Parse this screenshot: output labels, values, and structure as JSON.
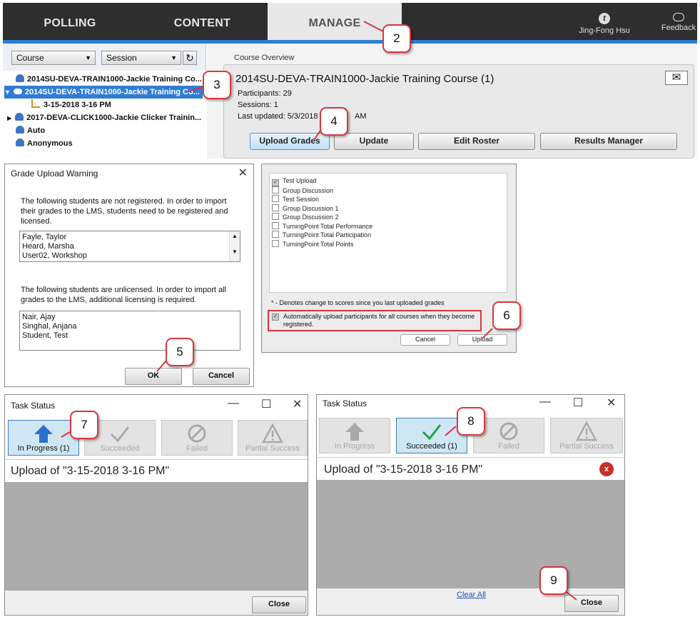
{
  "app": {
    "tabs": [
      "POLLING",
      "CONTENT",
      "MANAGE"
    ],
    "user_name": "Jing-Fong Hsu",
    "feedback_label": "Feedback",
    "course_dropdown": "Course",
    "session_dropdown": "Session",
    "tree": [
      {
        "label": "2014SU-DEVA-TRAIN1000-Jackie Training Co..."
      },
      {
        "label": "2014SU-DEVA-TRAIN1000-Jackie Training Co..."
      },
      {
        "label": "3-15-2018 3-16 PM"
      },
      {
        "label": "2017-DEVA-CLICK1000-Jackie Clicker Trainin..."
      },
      {
        "label": "Auto"
      },
      {
        "label": "Anonymous"
      }
    ],
    "overview_heading": "Course Overview",
    "course_title": "2014SU-DEVA-TRAIN1000-Jackie Training Course (1)",
    "participants": "Participants: 29",
    "sessions": "Sessions: 1",
    "last_updated": "Last updated: 5/3/2018",
    "last_updated_time": "AM",
    "buttons": [
      "Upload Grades",
      "Update",
      "Edit Roster",
      "Results Manager"
    ]
  },
  "warning": {
    "title": "Grade Upload Warning",
    "msg1": "The following students are not registered. In order to import their grades to the LMS, students need to be registered and licensed.",
    "list1": [
      "Fayle, Taylor",
      "Heard, Marsha",
      "User02, Workshop"
    ],
    "msg2": "The following students are unlicensed. In order to import all grades to the LMS, additional licensing is required.",
    "list2": [
      "Nair, Ajay",
      "Singhal, Anjana",
      "Student, Test"
    ],
    "ok": "OK",
    "cancel": "Cancel"
  },
  "upload_dialog": {
    "items": [
      "Test Upload",
      "Group Discussion",
      "Test Session",
      "Group Discussion 1",
      "Group Discussion 2",
      "TurningPoint Total Performance",
      "TurningPoint Total Participation",
      "TurningPoint Total Points"
    ],
    "note": "* - Denotes change to scores since you last uploaded grades",
    "auto_label": "Automatically upload participants for all courses when they become registered.",
    "cancel": "Cancel",
    "upload": "Upload"
  },
  "task1": {
    "title": "Task Status",
    "tiles": [
      "In Progress (1)",
      "Succeeded",
      "Failed",
      "Partial Success"
    ],
    "upload_text": "Upload of \"3-15-2018 3-16 PM\"",
    "close": "Close"
  },
  "task2": {
    "title": "Task Status",
    "tiles": [
      "In Progress",
      "Succeeded (1)",
      "Failed",
      "Partial Success"
    ],
    "upload_text": "Upload of \"3-15-2018 3-16 PM\"",
    "clear_all": "Clear All",
    "close": "Close"
  },
  "callouts": [
    "2",
    "3",
    "4",
    "5",
    "6",
    "7",
    "8",
    "9"
  ],
  "colors": {
    "accent": "#2b7fd4",
    "callout_border": "#d9363e",
    "selection": "#2f7dd6"
  }
}
